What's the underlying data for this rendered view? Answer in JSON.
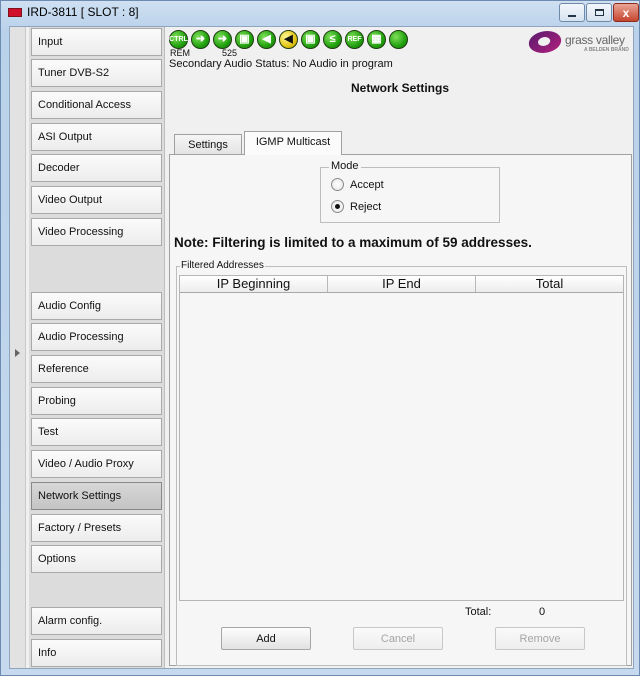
{
  "window": {
    "title": "IRD-3811 [ SLOT : 8]",
    "close_glyph": "x"
  },
  "nav": {
    "items": [
      {
        "label": "Input"
      },
      {
        "label": "Tuner DVB-S2"
      },
      {
        "label": "Conditional Access"
      },
      {
        "label": "ASI Output"
      },
      {
        "label": "Decoder"
      },
      {
        "label": "Video Output"
      },
      {
        "label": "Video Processing"
      },
      {
        "label": "Audio Config"
      },
      {
        "label": "Audio Processing"
      },
      {
        "label": "Reference"
      },
      {
        "label": "Probing"
      },
      {
        "label": "Test"
      },
      {
        "label": "Video / Audio Proxy"
      },
      {
        "label": "Network Settings",
        "active": true
      },
      {
        "label": "Factory / Presets"
      },
      {
        "label": "Options"
      },
      {
        "label": "Alarm config."
      },
      {
        "label": "Info"
      }
    ]
  },
  "status_bar": {
    "icons": [
      {
        "name": "ctrl-status-icon",
        "text": "CTRL",
        "color": "#22a10f"
      },
      {
        "name": "arrow-status-icon-1",
        "text": "➜",
        "color": "#22a10f"
      },
      {
        "name": "arrow-status-icon-2",
        "text": "➜",
        "color": "#22a10f"
      },
      {
        "name": "lock-status-icon",
        "text": "▣",
        "color": "#22a10f"
      },
      {
        "name": "speaker-status-icon",
        "text": "◀",
        "color": "#22a10f"
      },
      {
        "name": "audio-warning-status-icon",
        "text": "◀",
        "color": "#e2c615"
      },
      {
        "name": "audio-lock-status-icon",
        "text": "▣",
        "color": "#22a10f"
      },
      {
        "name": "less-than-status-icon",
        "text": "≤",
        "color": "#22a10f"
      },
      {
        "name": "ref-status-icon",
        "text": "REF",
        "color": "#22a10f"
      },
      {
        "name": "video-status-icon",
        "text": "▦",
        "color": "#22a10f"
      },
      {
        "name": "general-status-icon",
        "text": "",
        "color": "#22a10f"
      }
    ],
    "rem_label": "REM",
    "format_label": "525",
    "secondary_audio_status": "Secondary Audio Status: No Audio in program"
  },
  "logo": {
    "text": "grass valley",
    "subtext": "A BELDEN BRAND"
  },
  "page": {
    "title": "Network Settings"
  },
  "tabs": [
    {
      "label": "Settings",
      "active": false
    },
    {
      "label": "IGMP Multicast",
      "active": true
    }
  ],
  "mode": {
    "legend": "Mode",
    "options": [
      {
        "label": "Accept",
        "checked": false
      },
      {
        "label": "Reject",
        "checked": true
      }
    ]
  },
  "note": "Note: Filtering is limited to a maximum of 59 addresses.",
  "filtered": {
    "legend": "Filtered Addresses",
    "columns": [
      "IP Beginning",
      "IP End",
      "Total"
    ],
    "rows": [],
    "total_label": "Total:",
    "total_value": "0"
  },
  "buttons": {
    "add": "Add",
    "cancel": "Cancel",
    "remove": "Remove"
  }
}
